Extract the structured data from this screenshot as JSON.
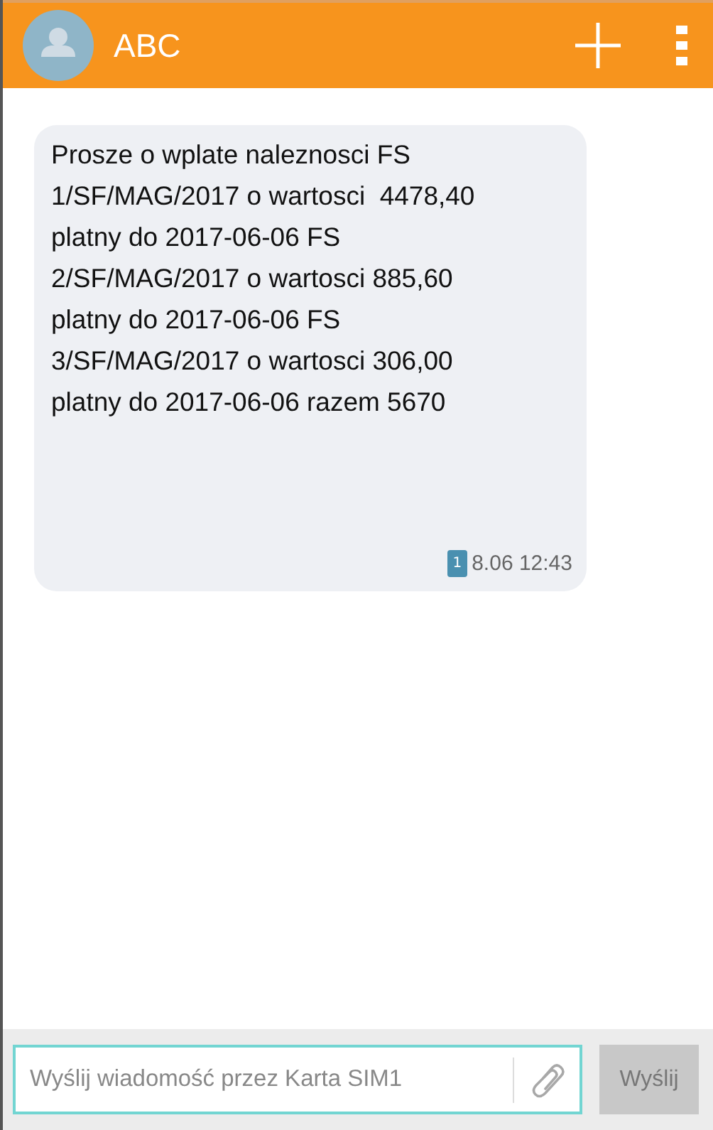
{
  "header": {
    "title": "ABC"
  },
  "messages": [
    {
      "text": "Prosze o wplate naleznosci FS\n1/SF/MAG/2017 o wartosci  4478,40\nplatny do 2017-06-06 FS\n2/SF/MAG/2017 o wartosci 885,60\nplatny do 2017-06-06 FS\n3/SF/MAG/2017 o wartosci 306,00\nplatny do 2017-06-06 razem 5670",
      "sim": "1",
      "time": "8.06 12:43"
    }
  ],
  "composer": {
    "placeholder": "Wyślij wiadomość przez Karta SIM1",
    "send_label": "Wyślij",
    "send_disabled": true
  }
}
